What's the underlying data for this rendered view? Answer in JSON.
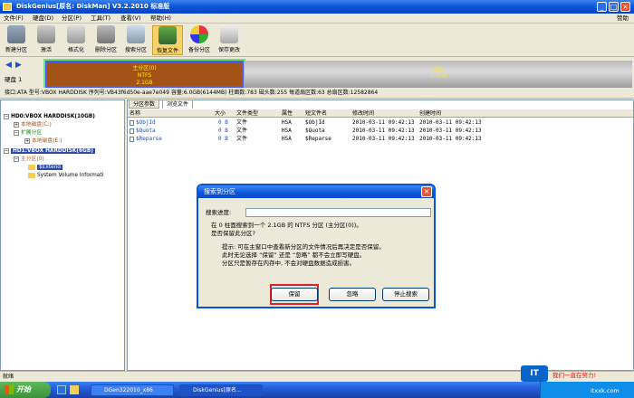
{
  "window": {
    "title": "DiskGenius[原名: DiskMan] V3.2.2010 标准版"
  },
  "menu": [
    "文件(F)",
    "硬盘(D)",
    "分区(P)",
    "工具(T)",
    "查看(V)",
    "帮助(H)"
  ],
  "help_label": "赞助",
  "toolbar": [
    "新建分区",
    "激活",
    "格式化",
    "删除分区",
    "搜索分区",
    "恢复文件",
    "备份分区",
    "保存更改"
  ],
  "disk": {
    "label": "硬盘 1",
    "part_a": {
      "line1": "主分区(0)",
      "line2": "NTFS",
      "line3": "2.1GB"
    },
    "part_b": {
      "line1": "空闲",
      "line2": "3.9GB"
    },
    "info": "接口:ATA  型号:VBOX HARDDISK  序列号:VB43f6d50e-aae7e049  容量:6.0GB(6144MB)  柱面数:783  磁头数:255  每道扇区数:63  总扇区数:12582864"
  },
  "tree": {
    "hd0": "HD0:VBOX HARDDISK(10GB)",
    "hd0_local_c": "本地磁盘(C:)",
    "hd0_ext": "扩展分区",
    "hd0_local_e": "本地磁盘(E:)",
    "hd1": "HD1:VBOX HARDDISK(6GB)",
    "hd1_primary": "主分区(0)",
    "extend": "$Extend",
    "svi": "System Volume Informati"
  },
  "tabs": [
    "分区参数",
    "浏览文件"
  ],
  "columns": [
    "名称",
    "大小",
    "文件类型",
    "属性",
    "短文件名",
    "修改时间",
    "创建时间"
  ],
  "files": [
    {
      "name": "$ObjId",
      "size": "0 B",
      "type": "文件",
      "attr": "HSA",
      "short": "$ObjId",
      "mtime": "2010-03-11 09:42:13",
      "ctime": "2010-03-11 09:42:13"
    },
    {
      "name": "$Quota",
      "size": "0 B",
      "type": "文件",
      "attr": "HSA",
      "short": "$Quota",
      "mtime": "2010-03-11 09:42:13",
      "ctime": "2010-03-11 09:42:13"
    },
    {
      "name": "$Reparse",
      "size": "0 B",
      "type": "文件",
      "attr": "HSA",
      "short": "$Reparse",
      "mtime": "2010-03-11 09:42:13",
      "ctime": "2010-03-11 09:42:13"
    }
  ],
  "dialog": {
    "title": "搜索到分区",
    "progress_label": "搜索进度:",
    "msg1": "在 0 柱面搜索到一个 2.1GB 的 NTFS 分区 (主分区(0))。",
    "msg2": "是否保留此分区?",
    "tip1": "提示: 可在主窗口中查看新分区的文件情况后再决定是否保留。",
    "tip2": "此时无论选择 “保留” 还是 “忽略” 都不会立即写硬盘。",
    "tip3": "分区只是暂存在内存中, 不会对硬盘数据造成损害。",
    "keep": "保留",
    "ignore": "忽略",
    "stop": "停止搜索"
  },
  "status": "就绪",
  "taskbar": {
    "start": "开始",
    "task1": "DGen322010_x86",
    "task2": "DiskGenius[原名..."
  },
  "watermark": {
    "logo": "IT",
    "slogan": "我们一直在努力!",
    "site": "itxxk.com"
  },
  "colors": {
    "accent": "#0855dd",
    "partition_fill": "#a45316",
    "highlight": "#d9242f"
  }
}
